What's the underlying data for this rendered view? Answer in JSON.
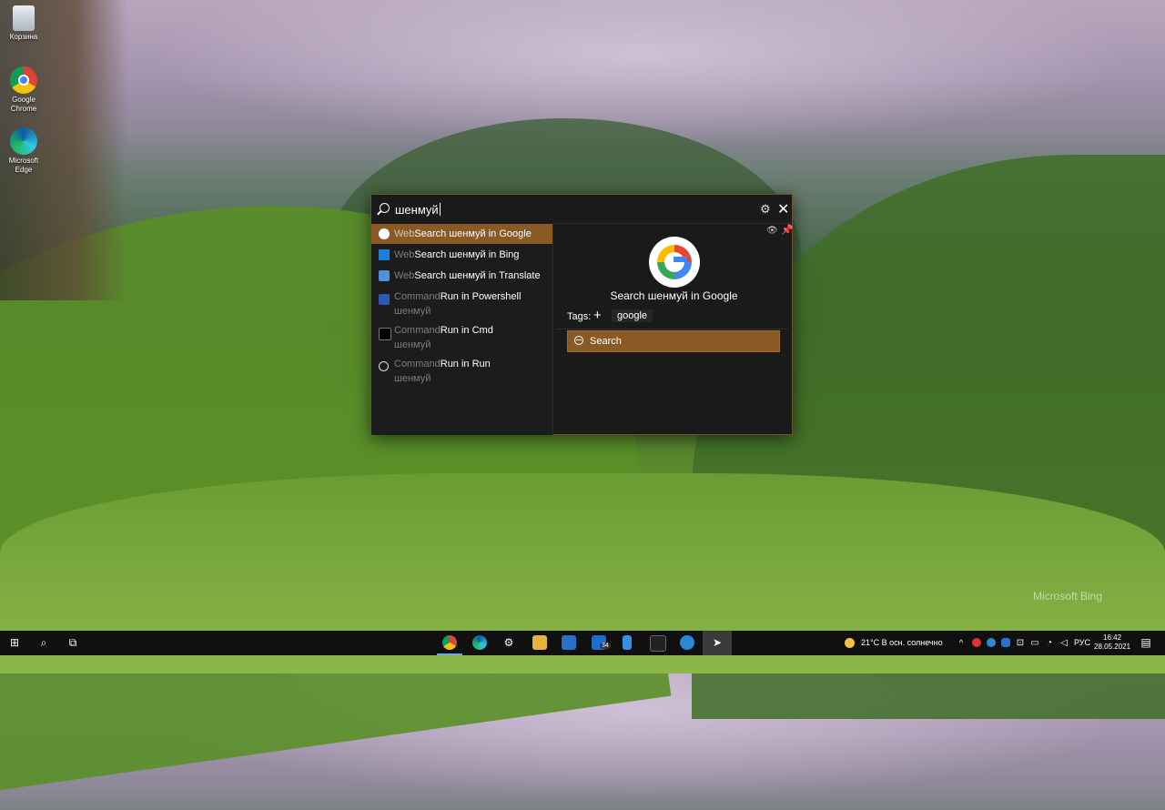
{
  "desktop": {
    "icons": [
      {
        "label": "Корзина",
        "icon": "recycle-bin-icon"
      },
      {
        "label": "Google Chrome",
        "icon": "chrome-icon"
      },
      {
        "label": "Microsoft Edge",
        "icon": "edge-icon"
      }
    ],
    "watermark": "Microsoft Bing"
  },
  "launcher": {
    "query": "шенмуй",
    "results": [
      {
        "category": "Web",
        "title": "Search шенмуй in Google",
        "subtitle": "",
        "icon": "google-icon",
        "selected": true
      },
      {
        "category": "Web",
        "title": "Search шенмуй in Bing",
        "subtitle": "",
        "icon": "bing-icon"
      },
      {
        "category": "Web",
        "title": "Search шенмуй in Translate",
        "subtitle": "",
        "icon": "translate-icon"
      },
      {
        "category": "Command",
        "title": "Run in Powershell",
        "subtitle": "шенмуй",
        "icon": "powershell-icon"
      },
      {
        "category": "Command",
        "title": "Run in Cmd",
        "subtitle": "шенмуй",
        "icon": "cmd-icon"
      },
      {
        "category": "Command",
        "title": "Run in Run",
        "subtitle": "шенмуй",
        "icon": "run-icon"
      }
    ],
    "preview": {
      "title": "Search шенмуй in Google",
      "tags_label": "Tags:",
      "tags": [
        "google"
      ],
      "action_label": "Search"
    },
    "accent": "#8a5a26"
  },
  "taskbar": {
    "weather": "21°C  В осн. солнечно",
    "language": "РУС",
    "time": "16:42",
    "date": "28.05.2021",
    "mail_badge": "34"
  }
}
